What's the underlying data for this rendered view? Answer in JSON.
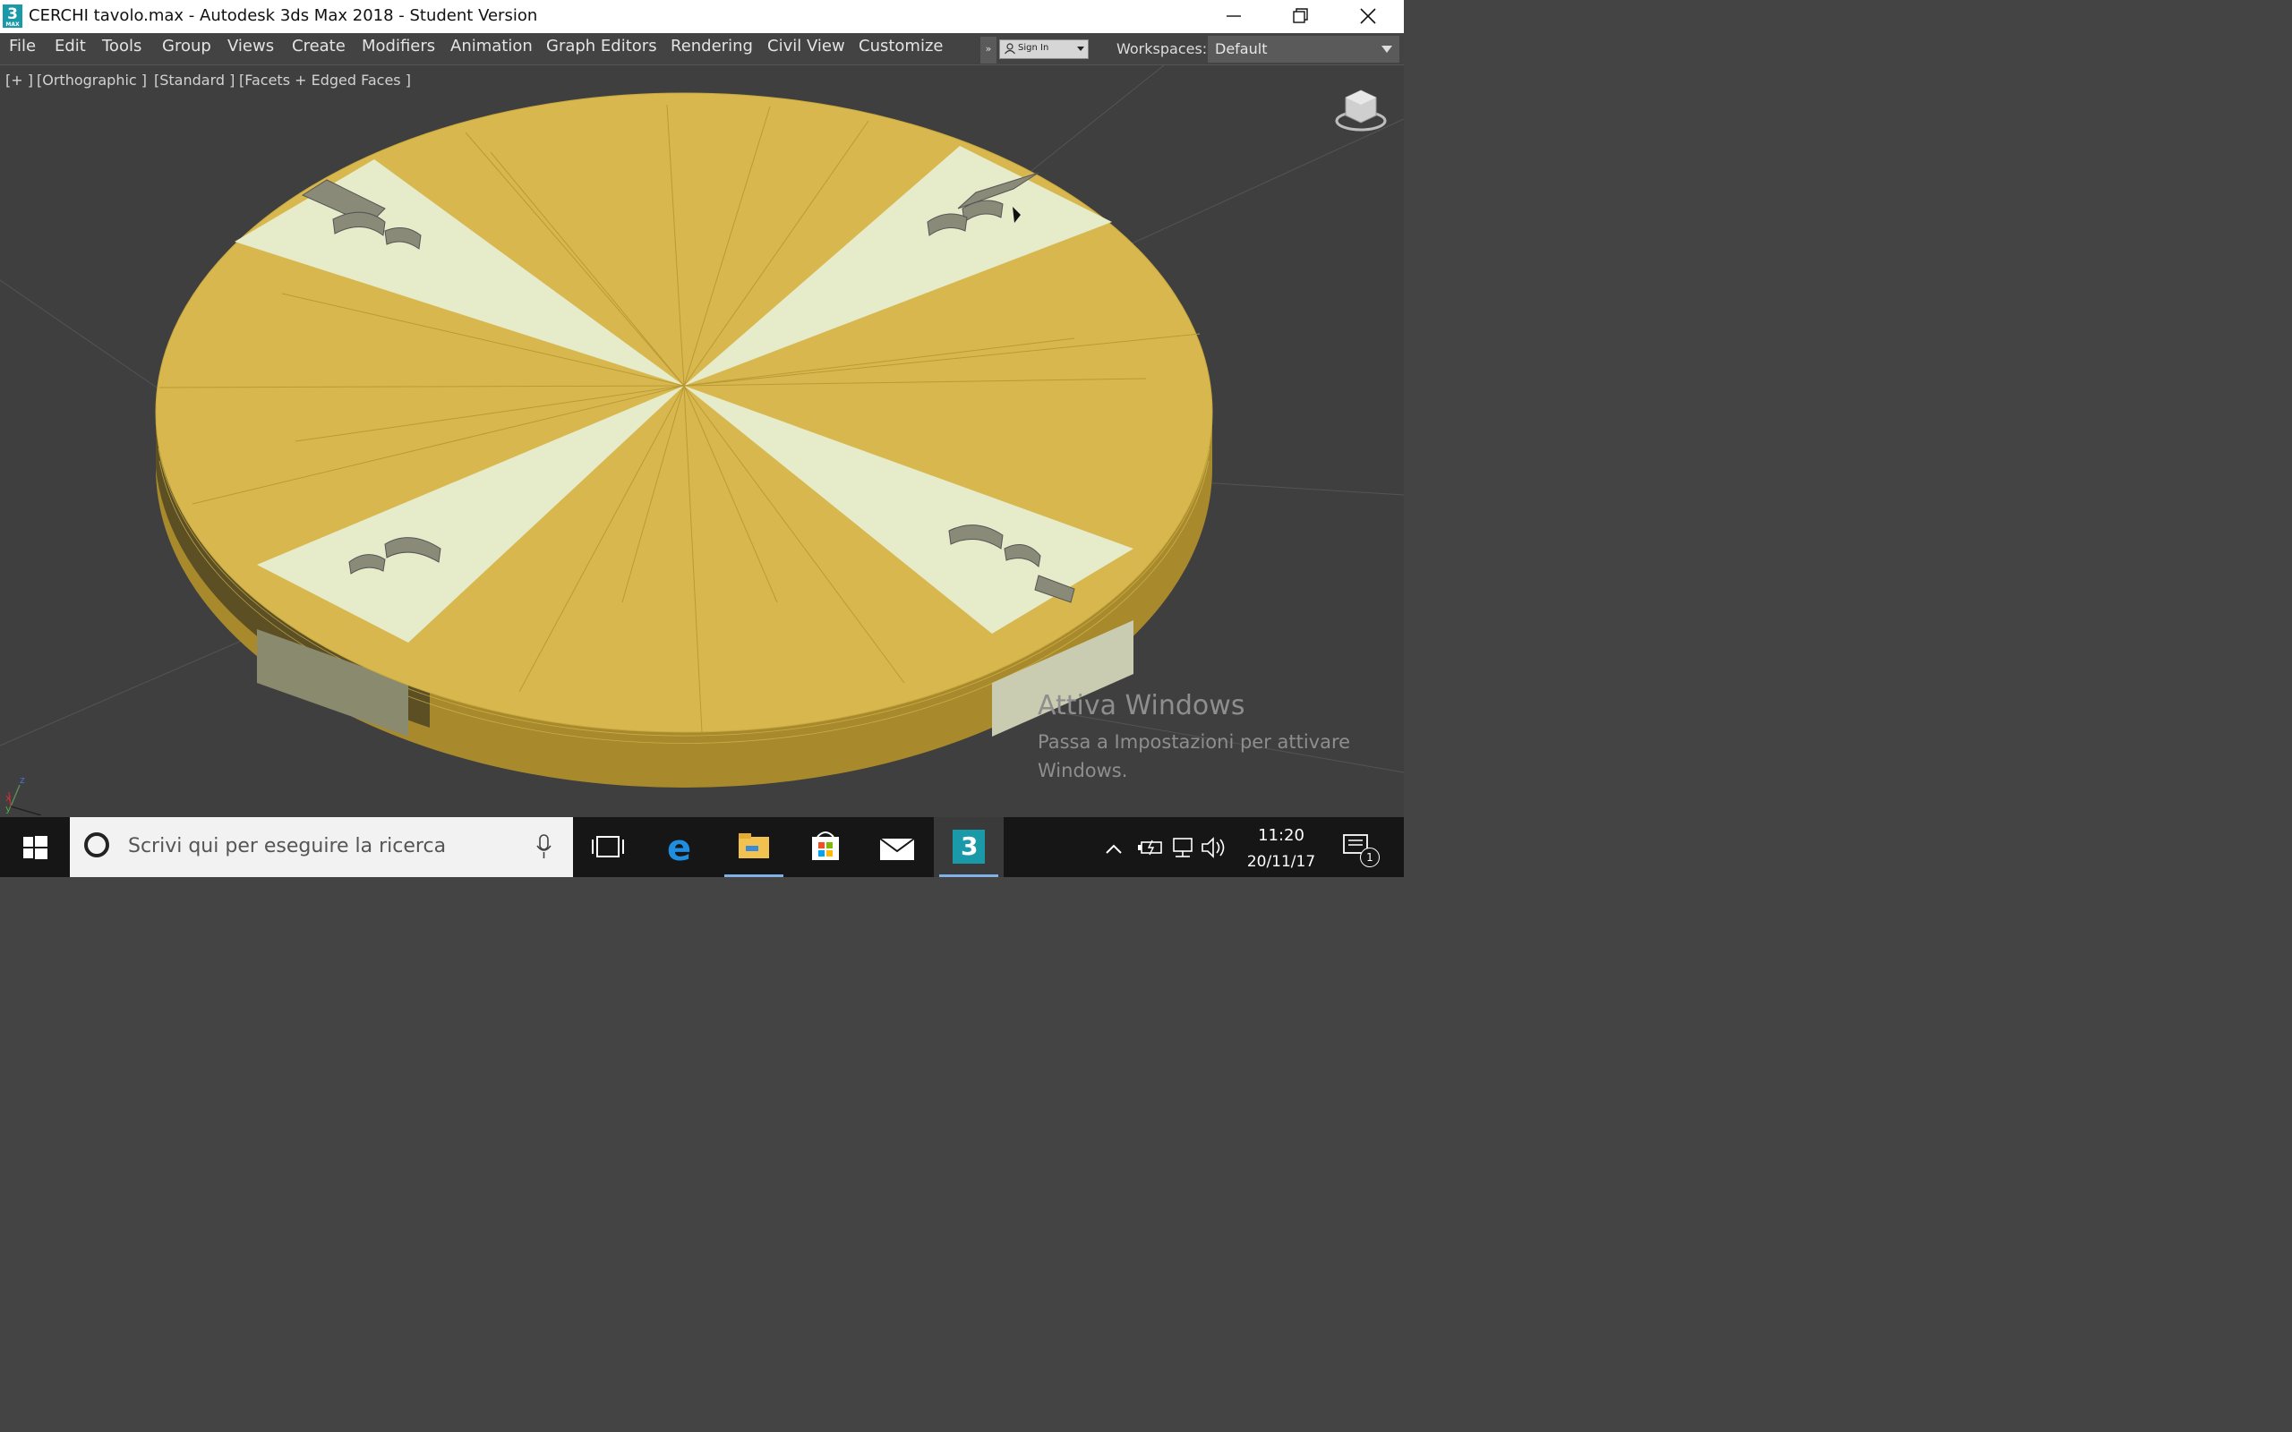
{
  "window": {
    "title": "CERCHI tavolo.max - Autodesk 3ds Max 2018 - Student Version",
    "app_icon_glyph": "3",
    "app_icon_sub": "MAX"
  },
  "menu": [
    "File",
    "Edit",
    "Tools",
    "Group",
    "Views",
    "Create",
    "Modifiers",
    "Animation",
    "Graph Editors",
    "Rendering",
    "Civil View",
    "Customize"
  ],
  "toolbar": {
    "expand_glyph": "»",
    "signin_label": "Sign In",
    "workspaces_label": "Workspaces:",
    "workspace_value": "Default"
  },
  "viewport": {
    "labels": [
      "[+ ]",
      "[Orthographic ]",
      "[Standard ]",
      "[Facets + Edged Faces ]"
    ],
    "axis_z": "z",
    "axis_x": "x",
    "axis_y": "y"
  },
  "watermark": {
    "title": "Attiva Windows",
    "message": "Passa a Impostazioni per attivare Windows."
  },
  "taskbar": {
    "search_placeholder": "Scrivi qui per eseguire la ricerca",
    "apps": [
      "task-view",
      "edge",
      "file-explorer",
      "store",
      "mail",
      "3ds-max"
    ],
    "time": "11:20",
    "date": "20/11/17",
    "notification_count": "1"
  },
  "colors": {
    "accent_yellow": "#d8b84e",
    "selection_white": "#e6ebca",
    "viewport_bg": "#3f3f3f",
    "taskbar": "#161616"
  }
}
